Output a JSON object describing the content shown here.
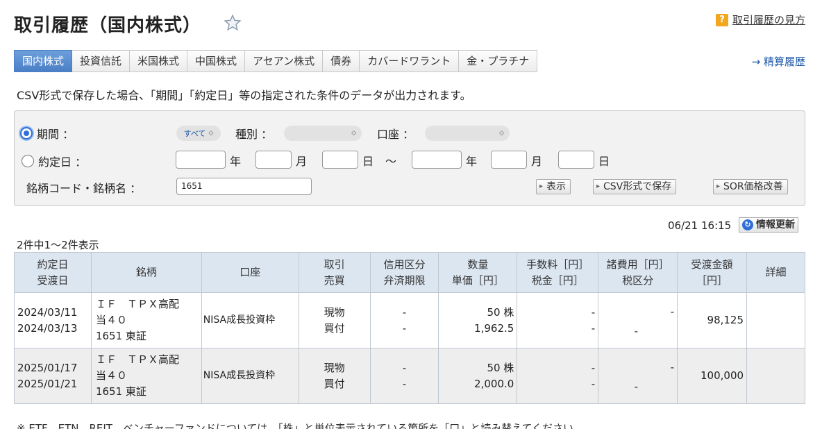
{
  "page": {
    "title": "取引履歴（国内株式）",
    "help_link": "取引履歴の見方",
    "help_icon": "?",
    "settlement_link": "→ 精算履歴"
  },
  "tabs": [
    "国内株式",
    "投資信託",
    "米国株式",
    "中国株式",
    "アセアン株式",
    "債券",
    "カバードワラント",
    "金・プラチナ"
  ],
  "description": "CSV形式で保存した場合、「期間」「約定日」等の指定された条件のデータが出力されます。",
  "filter": {
    "period_label": "期間 ：",
    "period_value": "すべて",
    "type_label": "種別 ：",
    "type_value": "",
    "account_label": "口座 ：",
    "account_value": "",
    "date_label": "約定日 ：",
    "year": "年",
    "month": "月",
    "day": "日",
    "tilde": "〜",
    "code_label": "銘柄コード・銘柄名 ：",
    "code_value": "1651",
    "btn_show": "表示",
    "btn_csv": "CSV形式で保存",
    "btn_sor": "SOR価格改善"
  },
  "update": {
    "time": "06/21 16:15",
    "button": "情報更新"
  },
  "count": "2件中1〜2件表示",
  "table": {
    "headers": [
      [
        "約定日",
        "受渡日"
      ],
      [
        "銘柄"
      ],
      [
        "口座"
      ],
      [
        "取引",
        "売買"
      ],
      [
        "信用区分",
        "弁済期限"
      ],
      [
        "数量",
        "単価［円］"
      ],
      [
        "手数料［円］",
        "税金［円］"
      ],
      [
        "諸費用［円］",
        "税区分"
      ],
      [
        "受渡金額",
        "［円］"
      ],
      [
        "詳細"
      ]
    ],
    "rows": [
      {
        "trade_date": "2024/03/11",
        "settle_date": "2024/03/13",
        "name1": "ＩＦ　ＴＰＸ高配",
        "name2": "当４０",
        "name3": "1651 東証",
        "account": "NISA成長投資枠",
        "trade": "現物",
        "side": "買付",
        "credit": "-",
        "due": "-",
        "qty": "50 株",
        "price": "1,962.5",
        "fee": "-",
        "tax": "-",
        "exp": "-",
        "taxcat": "-",
        "amount": "98,125",
        "detail": ""
      },
      {
        "trade_date": "2025/01/17",
        "settle_date": "2025/01/21",
        "name1": "ＩＦ　ＴＰＸ高配",
        "name2": "当４０",
        "name3": "1651 東証",
        "account": "NISA成長投資枠",
        "trade": "現物",
        "side": "買付",
        "credit": "-",
        "due": "-",
        "qty": "50 株",
        "price": "2,000.0",
        "fee": "-",
        "tax": "-",
        "exp": "-",
        "taxcat": "-",
        "amount": "100,000",
        "detail": ""
      }
    ]
  },
  "footnote": "※ ETF、ETN、REIT、ベンチャーファンドについては、「株」と単位表示されている箇所を「口」と読み替えてください。"
}
